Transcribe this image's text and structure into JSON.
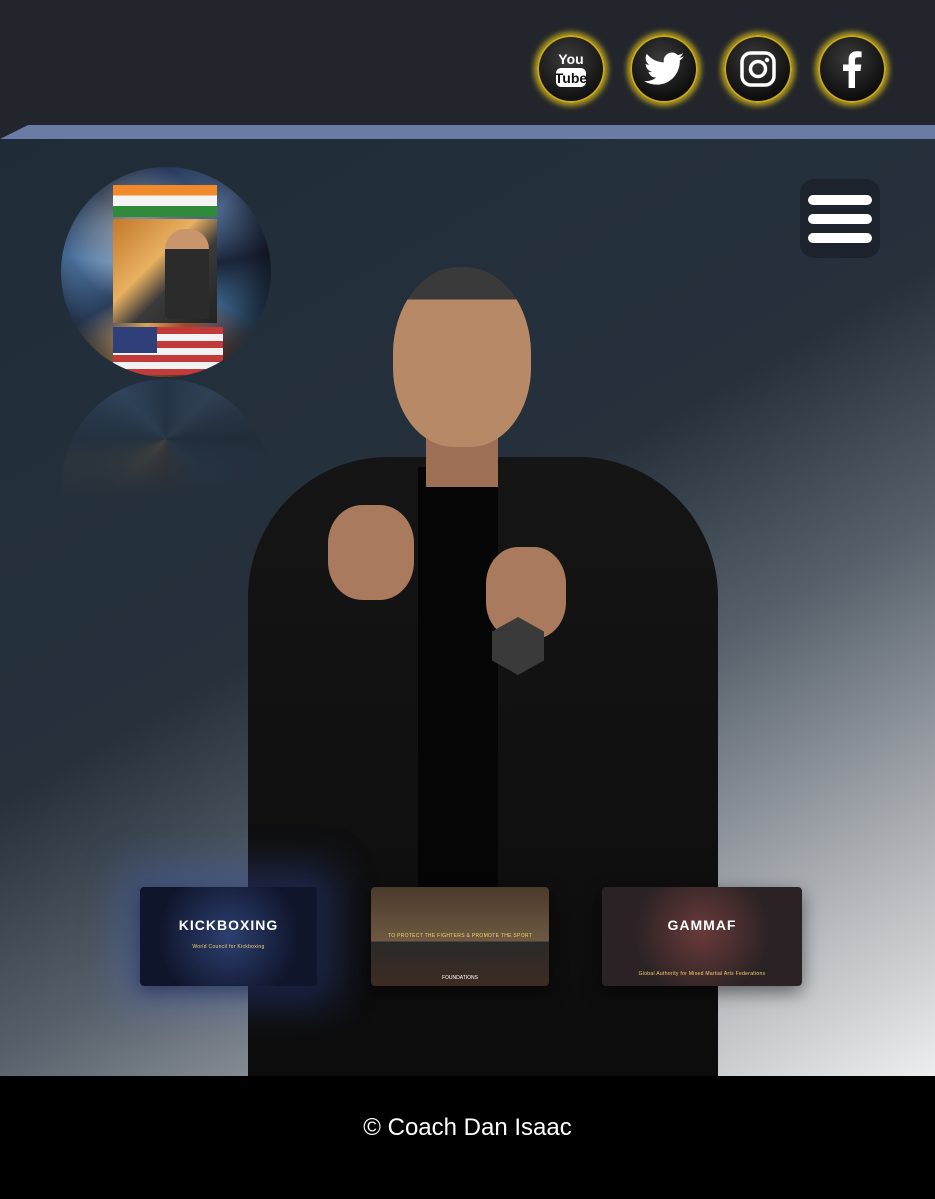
{
  "header": {
    "social": [
      {
        "name": "youtube",
        "icon": "youtube-icon",
        "label": "You Tube"
      },
      {
        "name": "twitter",
        "icon": "twitter-bird-icon"
      },
      {
        "name": "instagram",
        "icon": "instagram-icon"
      },
      {
        "name": "facebook",
        "icon": "facebook-icon"
      }
    ],
    "ring_color": "#e6c81e"
  },
  "accent_strip_color": "#6a7ca5",
  "hero": {
    "menu_icon": "hamburger-menu-icon",
    "globe_icon": "photo-globe",
    "portrait": "coach-portrait",
    "thumbnails": [
      {
        "big": "KICKBOXING",
        "caption": "World Council for Kickboxing"
      },
      {
        "big": "",
        "caption": "TO PROTECT THE FIGHTERS & PROMOTE THE SPORT",
        "footer": "FOUNDATIONS"
      },
      {
        "big": "GAMMAF",
        "caption": "Global Authority for Mixed Martial Arts Federations"
      }
    ]
  },
  "footer": {
    "copyright": "© Coach Dan Isaac"
  }
}
